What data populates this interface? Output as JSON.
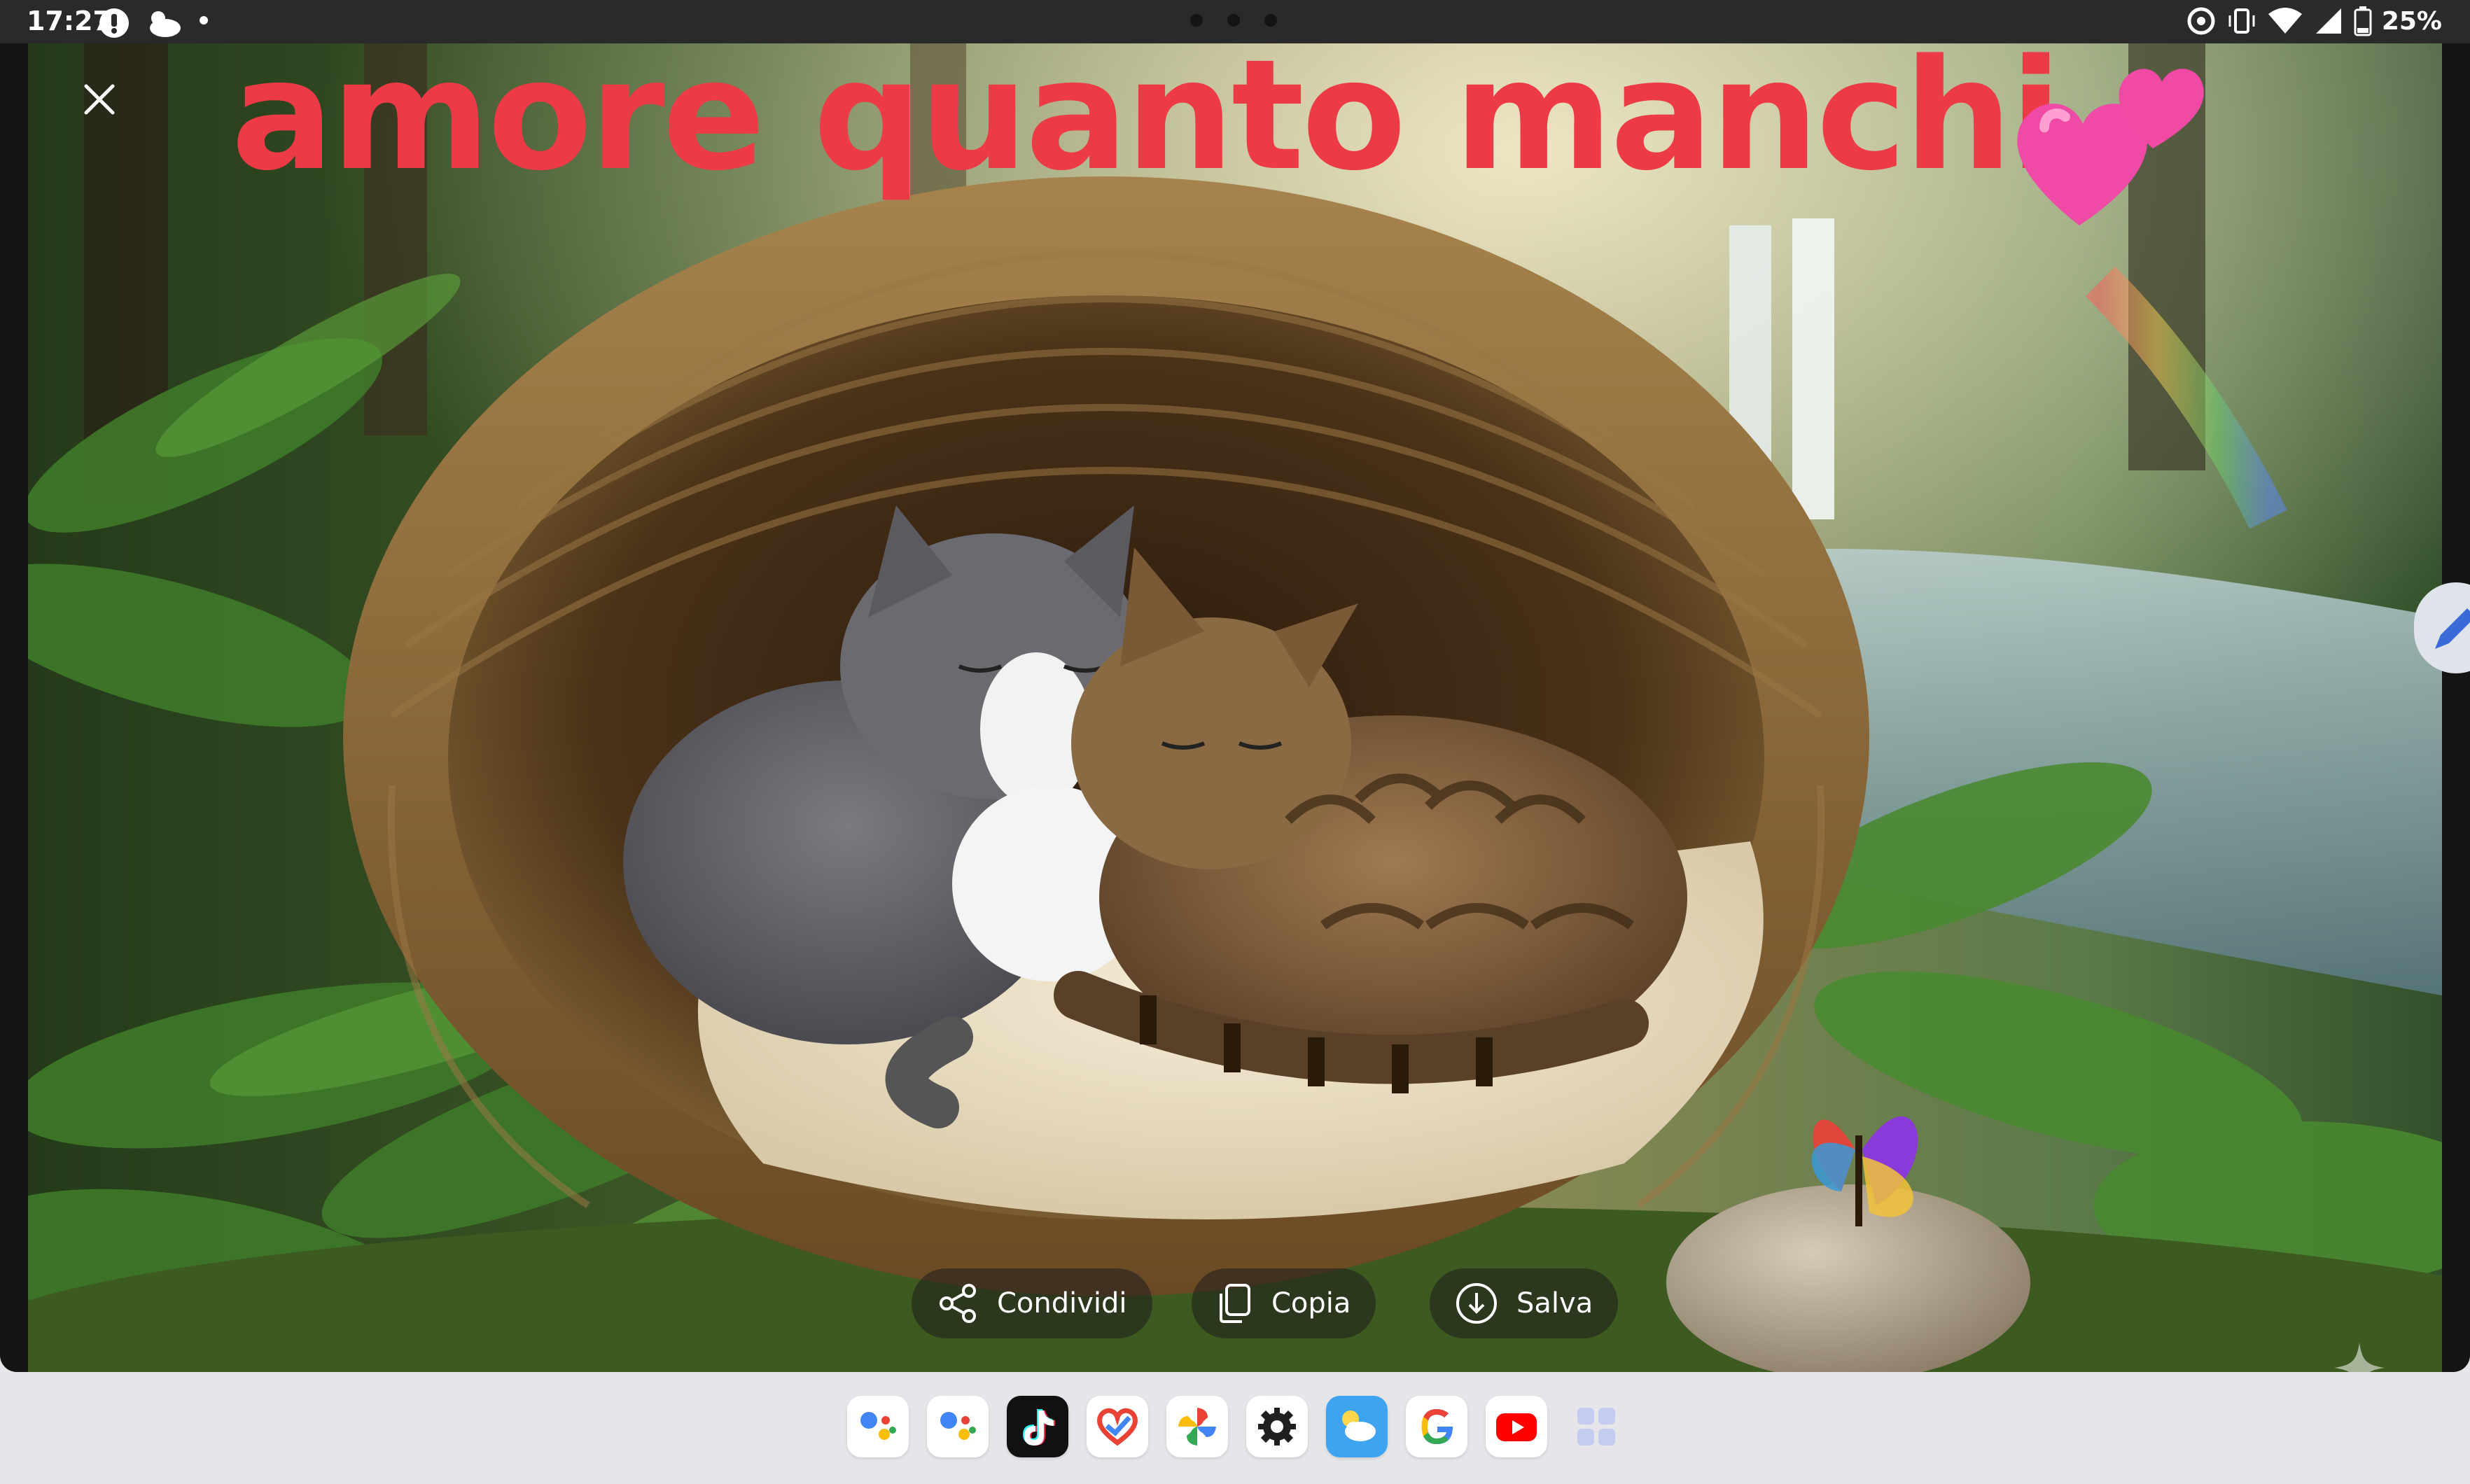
{
  "status_bar": {
    "time": "17:27",
    "battery": "25%"
  },
  "overlay": {
    "caption": "amore quanto manchi",
    "caption_color": "#ec3a46"
  },
  "actions": {
    "share_label": "Condividi",
    "copy_label": "Copia",
    "save_label": "Salva"
  },
  "dock": {
    "apps": [
      "google-assistant-icon",
      "google-assistant-icon",
      "tiktok-icon",
      "health-icon",
      "pinwheel-photos-icon",
      "settings-icon",
      "weather-icon",
      "google-icon",
      "youtube-icon",
      "app-drawer-icon"
    ]
  }
}
